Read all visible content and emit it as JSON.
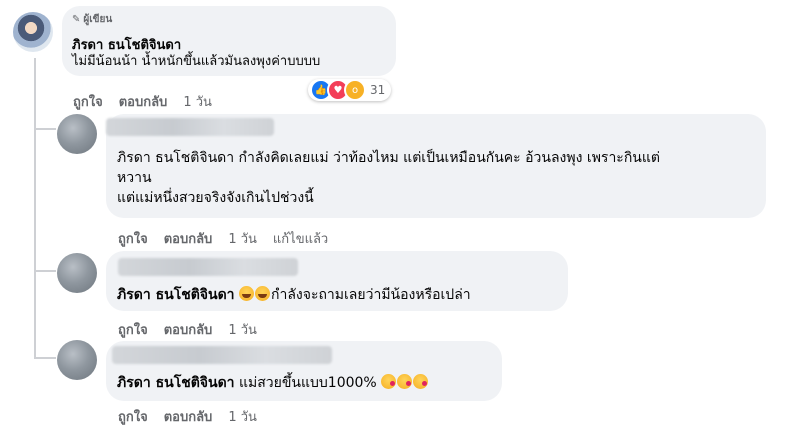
{
  "main_comment": {
    "author_badge": "ผู้เขียน",
    "author": "ภิรดา ธนโชติจินดา",
    "text": "ไม่มีน้อนน้า น้ำหนักขึ้นแล้วมันลงพุงค่าบบบบ",
    "actions": {
      "like": "ถูกใจ",
      "reply": "ตอบกลับ",
      "time": "1 วัน"
    },
    "reaction_count": "31",
    "reactions": [
      "like-icon",
      "love-icon",
      "wow-icon"
    ]
  },
  "replies": [
    {
      "mention": "ภิรดา ธนโชติจินดา",
      "text_line1": " กำลังคิดเลยแม่ ว่าท้องไหม แต่เป็นเหมือนกันคะ อ้วนลงพุง เพราะกินแต่",
      "text_line2": "หวาน",
      "text_line3": "แต่แม่หนึ่งสวยจริงจังเกินไปช่วงนี้",
      "actions": {
        "like": "ถูกใจ",
        "reply": "ตอบกลับ",
        "time": "1 วัน",
        "edited": "แก้ไขแล้ว"
      }
    },
    {
      "mention": "ภิรดา ธนโชติจินดา",
      "text": "กำลังจะถามเลยว่ามีน้องหรือเปล่า",
      "emojis": [
        "laughing-emoji",
        "laughing-emoji"
      ],
      "actions": {
        "like": "ถูกใจ",
        "reply": "ตอบกลับ",
        "time": "1 วัน"
      }
    },
    {
      "mention": "ภิรดา ธนโชติจินดา",
      "text": " แม่สวยขึ้นแบบ1000% ",
      "emojis": [
        "kiss-emoji",
        "kiss-emoji",
        "kiss-emoji"
      ],
      "actions": {
        "like": "ถูกใจ",
        "reply": "ตอบกลับ",
        "time": "1 วัน"
      }
    }
  ]
}
